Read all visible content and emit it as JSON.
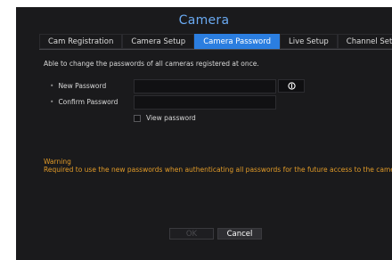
{
  "window": {
    "title": "Camera"
  },
  "tabs": [
    {
      "label": "Cam Registration",
      "active": false
    },
    {
      "label": "Camera Setup",
      "active": false
    },
    {
      "label": "Camera Password",
      "active": true
    },
    {
      "label": "Live Setup",
      "active": false
    },
    {
      "label": "Channel Setup",
      "active": false
    }
  ],
  "description": "Able to change the passwords of all cameras registered at once.",
  "form": {
    "new_password_label": "New Password",
    "new_password_value": "",
    "confirm_password_label": "Confirm Password",
    "confirm_password_value": "",
    "view_password_label": "View password",
    "view_password_checked": false,
    "info_icon": "info-icon"
  },
  "warning": {
    "title": "Warning",
    "text": "Required to use the new passwords when authenticating all passwords for the future access to the camera"
  },
  "buttons": {
    "ok_label": "OK",
    "cancel_label": "Cancel"
  },
  "colors": {
    "title": "#6aaaf2",
    "active_tab": "#2b7ee0",
    "warning": "#e09a28",
    "background": "#1a1a1c"
  }
}
